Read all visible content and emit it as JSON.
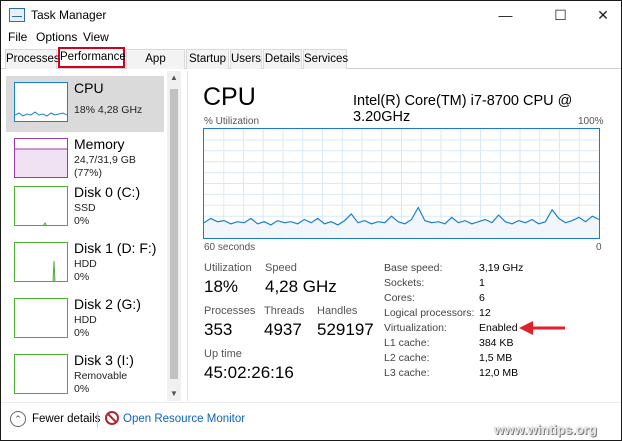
{
  "window": {
    "title": "Task Manager"
  },
  "menu": [
    "File",
    "Options",
    "View"
  ],
  "tabs": [
    "Processes",
    "Performance",
    "App history",
    "Startup",
    "Users",
    "Details",
    "Services"
  ],
  "sidebar": {
    "items": [
      {
        "name": "CPU",
        "line1": "18% 4,28 GHz",
        "line2": "",
        "selected": true
      },
      {
        "name": "Memory",
        "line1": "24,7/31,9 GB (77%)",
        "line2": ""
      },
      {
        "name": "Disk 0 (C:)",
        "line1": "SSD",
        "line2": "0%"
      },
      {
        "name": "Disk 1 (D: F:)",
        "line1": "HDD",
        "line2": "0%"
      },
      {
        "name": "Disk 2 (G:)",
        "line1": "HDD",
        "line2": "0%"
      },
      {
        "name": "Disk 3 (I:)",
        "line1": "Removable",
        "line2": "0%"
      }
    ]
  },
  "main": {
    "title": "CPU",
    "model": "Intel(R) Core(TM) i7-8700 CPU @ 3.20GHz",
    "graph_label": "% Utilization",
    "graph_max": "100%",
    "graph_time": "60 seconds",
    "graph_zero": "0",
    "stats": {
      "utilization_label": "Utilization",
      "utilization_value": "18%",
      "speed_label": "Speed",
      "speed_value": "4,28 GHz",
      "processes_label": "Processes",
      "processes_value": "353",
      "threads_label": "Threads",
      "threads_value": "4937",
      "handles_label": "Handles",
      "handles_value": "529197",
      "uptime_label": "Up time",
      "uptime_value": "45:02:26:16"
    },
    "details": [
      {
        "label": "Base speed:",
        "value": "3,19 GHz"
      },
      {
        "label": "Sockets:",
        "value": "1"
      },
      {
        "label": "Cores:",
        "value": "6"
      },
      {
        "label": "Logical processors:",
        "value": "12"
      },
      {
        "label": "Virtualization:",
        "value": "Enabled"
      },
      {
        "label": "L1 cache:",
        "value": "384 KB"
      },
      {
        "label": "L2 cache:",
        "value": "1,5 MB"
      },
      {
        "label": "L3 cache:",
        "value": "12,0 MB"
      }
    ],
    "utilization_history": [
      14,
      18,
      15,
      16,
      13,
      15,
      14,
      18,
      13,
      15,
      12,
      16,
      14,
      15,
      13,
      17,
      14,
      18,
      13,
      15,
      12,
      16,
      22,
      14,
      16,
      13,
      15,
      14,
      20,
      15,
      13,
      17,
      28,
      16,
      14,
      15,
      13,
      19,
      14,
      16,
      13,
      15,
      17,
      14,
      21,
      15,
      13,
      16,
      14,
      17,
      13,
      15,
      26,
      18,
      14,
      16,
      19,
      15,
      20,
      17
    ]
  },
  "footer": {
    "fewer_details": "Fewer details",
    "resource_monitor": "Open Resource Monitor"
  },
  "watermark": "www.wintips.org",
  "colors": {
    "cpu": "#1d7fd1",
    "memory": "#9b3ba5",
    "disk": "#4dad32",
    "annotation": "#e0202a",
    "link": "#0a64c2"
  }
}
